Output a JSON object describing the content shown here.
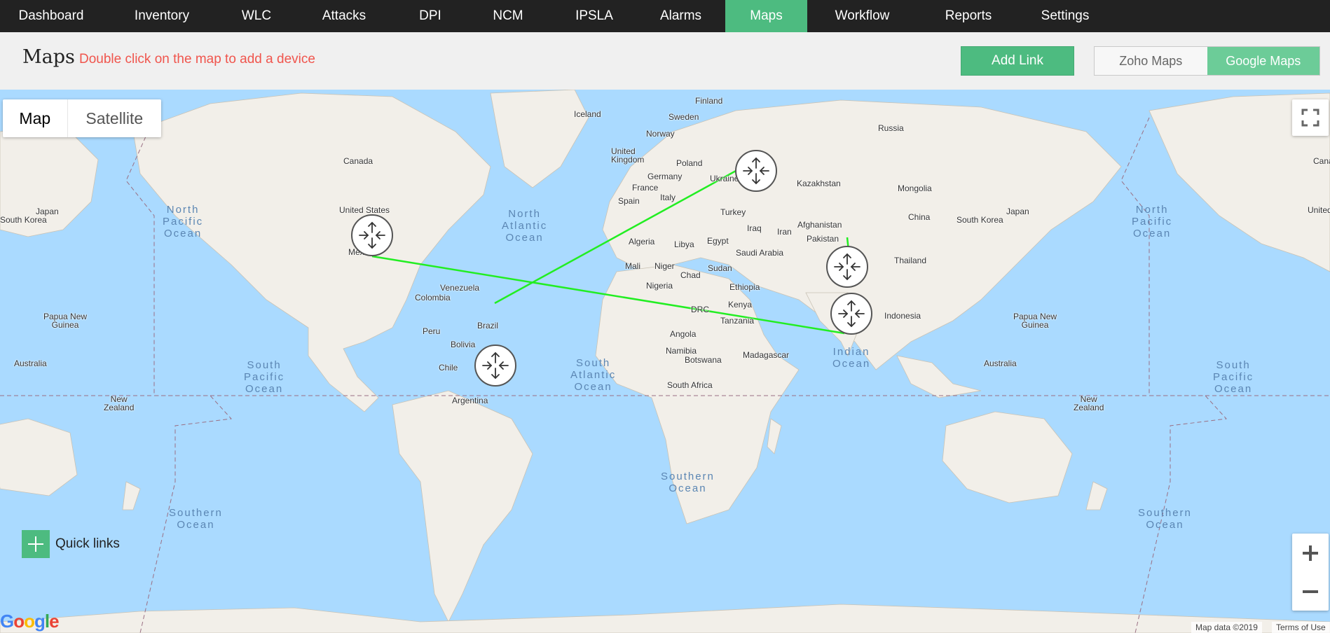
{
  "nav": {
    "items": [
      {
        "label": "Dashboard",
        "active": false
      },
      {
        "label": "Inventory",
        "active": false
      },
      {
        "label": "WLC",
        "active": false
      },
      {
        "label": "Attacks",
        "active": false
      },
      {
        "label": "DPI",
        "active": false
      },
      {
        "label": "NCM",
        "active": false
      },
      {
        "label": "IPSLA",
        "active": false
      },
      {
        "label": "Alarms",
        "active": false
      },
      {
        "label": "Maps",
        "active": true
      },
      {
        "label": "Workflow",
        "active": false
      },
      {
        "label": "Reports",
        "active": false
      },
      {
        "label": "Settings",
        "active": false
      }
    ]
  },
  "header": {
    "title": "Maps",
    "hint": "Double click on the map to add a device",
    "add_link_label": "Add Link",
    "map_providers": [
      "Zoho Maps",
      "Google Maps"
    ],
    "active_provider": "Google Maps"
  },
  "map": {
    "type_options": [
      "Map",
      "Satellite"
    ],
    "active_type": "Map",
    "zoom_in": "+",
    "zoom_out": "−",
    "quick_links_label": "Quick links",
    "google_logo": "Google",
    "map_data": "Map data ©2019",
    "terms": "Terms of Use",
    "labels": {
      "canada": "Canada",
      "united_states": "United States",
      "mexico": "Mexico",
      "japan": "Japan",
      "south_korea": "South Korea",
      "iceland": "Iceland",
      "finland": "Finland",
      "sweden": "Sweden",
      "norway": "Norway",
      "united_kingdom": "United\nKingdom",
      "poland": "Poland",
      "germany": "Germany",
      "ukraine": "Ukraine",
      "france": "France",
      "italy": "Italy",
      "spain": "Spain",
      "russia": "Russia",
      "kazakhstan": "Kazakhstan",
      "mongolia": "Mongolia",
      "china": "China",
      "turkey": "Turkey",
      "iraq": "Iraq",
      "iran": "Iran",
      "afghanistan": "Afghanistan",
      "pakistan": "Pakistan",
      "algeria": "Algeria",
      "libya": "Libya",
      "egypt": "Egypt",
      "saudi_arabia": "Saudi Arabia",
      "mali": "Mali",
      "niger": "Niger",
      "chad": "Chad",
      "sudan": "Sudan",
      "nigeria": "Nigeria",
      "ethiopia": "Ethiopia",
      "thailand": "Thailand",
      "venezuela": "Venezuela",
      "colombia": "Colombia",
      "brazil": "Brazil",
      "peru": "Peru",
      "bolivia": "Bolivia",
      "chile": "Chile",
      "argentina": "Argentina",
      "drc": "DRC",
      "kenya": "Kenya",
      "tanzania": "Tanzania",
      "angola": "Angola",
      "namibia": "Namibia",
      "botswana": "Botswana",
      "madagascar": "Madagascar",
      "south_africa": "South Africa",
      "indonesia": "Indonesia",
      "papua_new_guinea": "Papua New\nGuinea",
      "papua_new_guinea_2": "Papua New\nGuinea",
      "australia": "Australia",
      "australia_2": "Australia",
      "new_zealand": "New\nZealand",
      "new_zealand_2": "New\nZealand",
      "japan_2": "Japan",
      "south_korea_2": "South Korea",
      "united_states_2": "United",
      "canada_2": "Cana",
      "north_pacific": "North\nPacific\nOcean",
      "north_pacific_2": "North\nPacific\nOcean",
      "north_atlantic": "North\nAtlantic\nOcean",
      "south_pacific": "South\nPacific\nOcean",
      "south_pacific_2": "South\nPacific\nOcean",
      "south_atlantic": "South\nAtlantic\nOcean",
      "indian_ocean": "Indian\nOcean",
      "southern_ocean": "Southern\nOcean",
      "southern_ocean_2": "Southern\nOcean",
      "southern_ocean_3": "Southern\nOcean"
    }
  },
  "colors": {
    "nav_bg": "#222222",
    "accent": "#4dbb80",
    "hint": "#f0554d",
    "link_line": "#22ee22",
    "water": "#aadaff",
    "land": "#f2efe9"
  }
}
